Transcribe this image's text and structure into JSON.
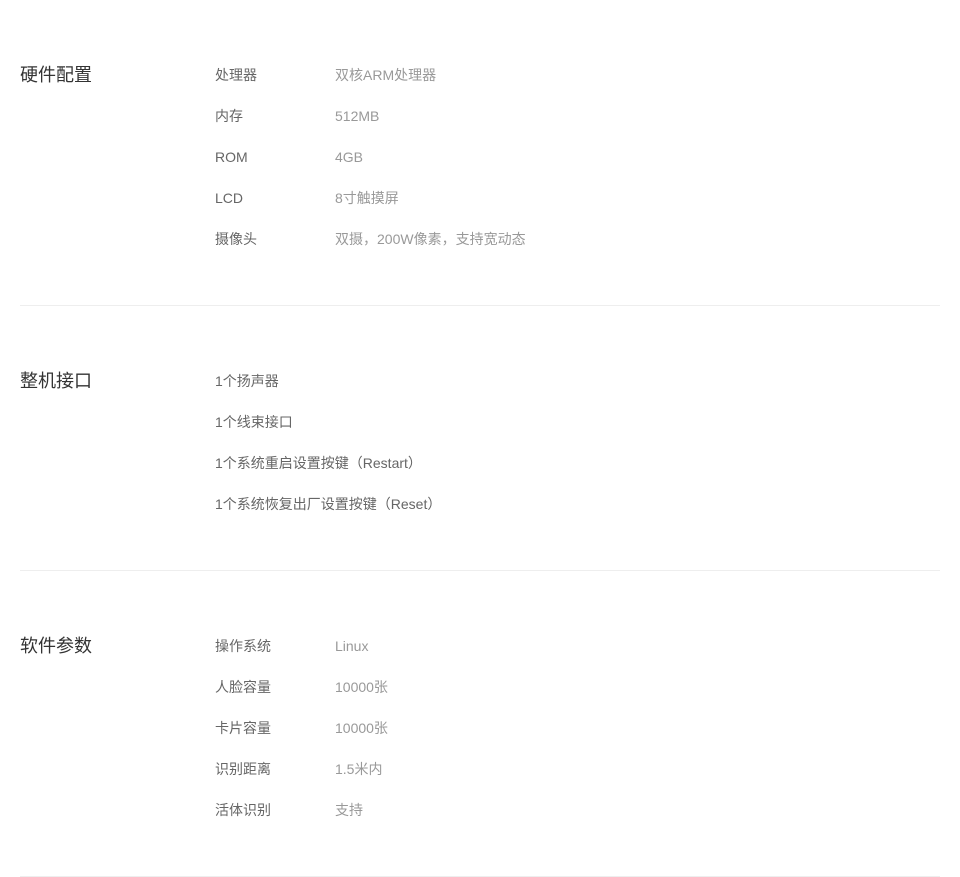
{
  "sections": [
    {
      "title": "硬件配置",
      "rows": [
        {
          "label": "处理器",
          "value": "双核ARM处理器"
        },
        {
          "label": "内存",
          "value": "512MB"
        },
        {
          "label": "ROM",
          "value": "4GB"
        },
        {
          "label": "LCD",
          "value": "8寸触摸屏"
        },
        {
          "label": "摄像头",
          "value": "双摄，200W像素，支持宽动态"
        }
      ]
    },
    {
      "title": "整机接口",
      "items": [
        "1个扬声器",
        "1个线束接口",
        "1个系统重启设置按键（Restart）",
        "1个系统恢复出厂设置按键（Reset）"
      ]
    },
    {
      "title": "软件参数",
      "rows": [
        {
          "label": "操作系统",
          "value": "Linux"
        },
        {
          "label": "人脸容量",
          "value": "10000张"
        },
        {
          "label": "卡片容量",
          "value": "10000张"
        },
        {
          "label": "识别距离",
          "value": "1.5米内"
        },
        {
          "label": "活体识别",
          "value": "支持"
        }
      ]
    }
  ]
}
